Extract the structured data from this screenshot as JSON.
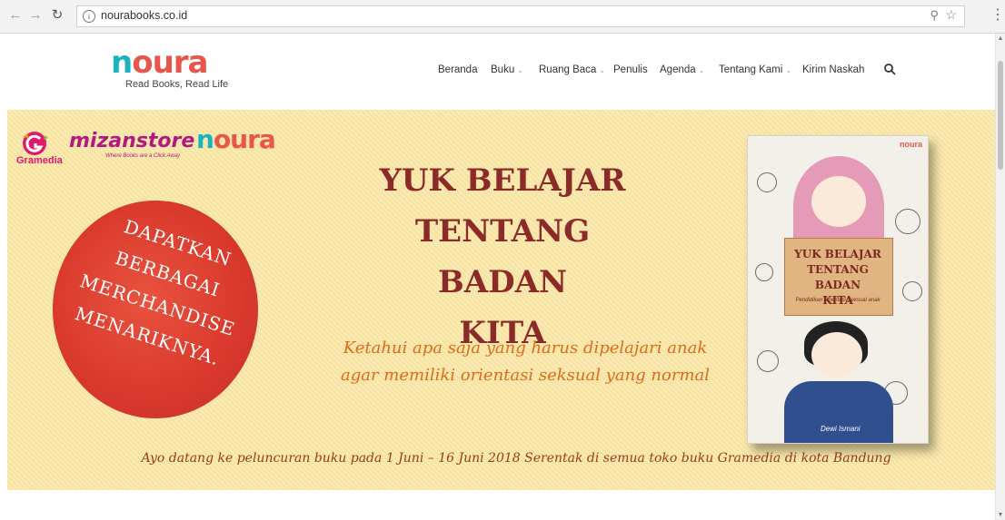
{
  "browser": {
    "url": "nourabooks.co.id"
  },
  "site": {
    "logo_text": "noura",
    "tagline": "Read Books, Read Life",
    "nav": [
      {
        "label": "Beranda",
        "has_dropdown": false
      },
      {
        "label": "Buku",
        "has_dropdown": true
      },
      {
        "label": "Ruang Baca",
        "has_dropdown": true
      },
      {
        "label": "Penulis",
        "has_dropdown": false
      },
      {
        "label": "Agenda",
        "has_dropdown": true
      },
      {
        "label": "Tentang Kami",
        "has_dropdown": true
      },
      {
        "label": "Kirim Naskah",
        "has_dropdown": false
      }
    ]
  },
  "hero": {
    "partner_1": "Gramedia",
    "partner_2": "mizanstore",
    "partner_2_tagline": "Where Books are a Click Away",
    "partner_3": "noura",
    "promo_lines": [
      "DAPATKAN",
      "BERBAGAI",
      "MERCHANDISE",
      "MENARIKNYA."
    ],
    "headline_lines": [
      "YUK BELAJAR",
      "TENTANG BADAN",
      "KITA"
    ],
    "sub_lines": [
      "Ketahui apa saja yang harus dipelajari anak",
      "agar memiliki orientasi seksual yang normal"
    ],
    "bottom_line": "Ayo datang ke peluncuran buku pada 1 Juni – 16 Juni 2018 Serentak di semua toko buku Gramedia di kota Bandung",
    "book": {
      "brand": "noura",
      "title_lines": [
        "YUK BELAJAR",
        "TENTANG BADAN",
        "KITA"
      ],
      "subtitle": "Pendidikan Orientasi Seksual anak",
      "author": "Dewi Ismani"
    }
  },
  "colors": {
    "banner_bg": "#fbe7a6",
    "headline": "#8c2a2a",
    "subline": "#e06b1c",
    "promo_circle": "#d9382c",
    "noura_teal": "#1ab3bf",
    "noura_coral": "#e8564a"
  },
  "icons": [
    "back-arrow-icon",
    "forward-arrow-icon",
    "reload-icon",
    "info-icon",
    "zoom-icon",
    "star-icon",
    "menu-dots-icon",
    "search-icon"
  ]
}
